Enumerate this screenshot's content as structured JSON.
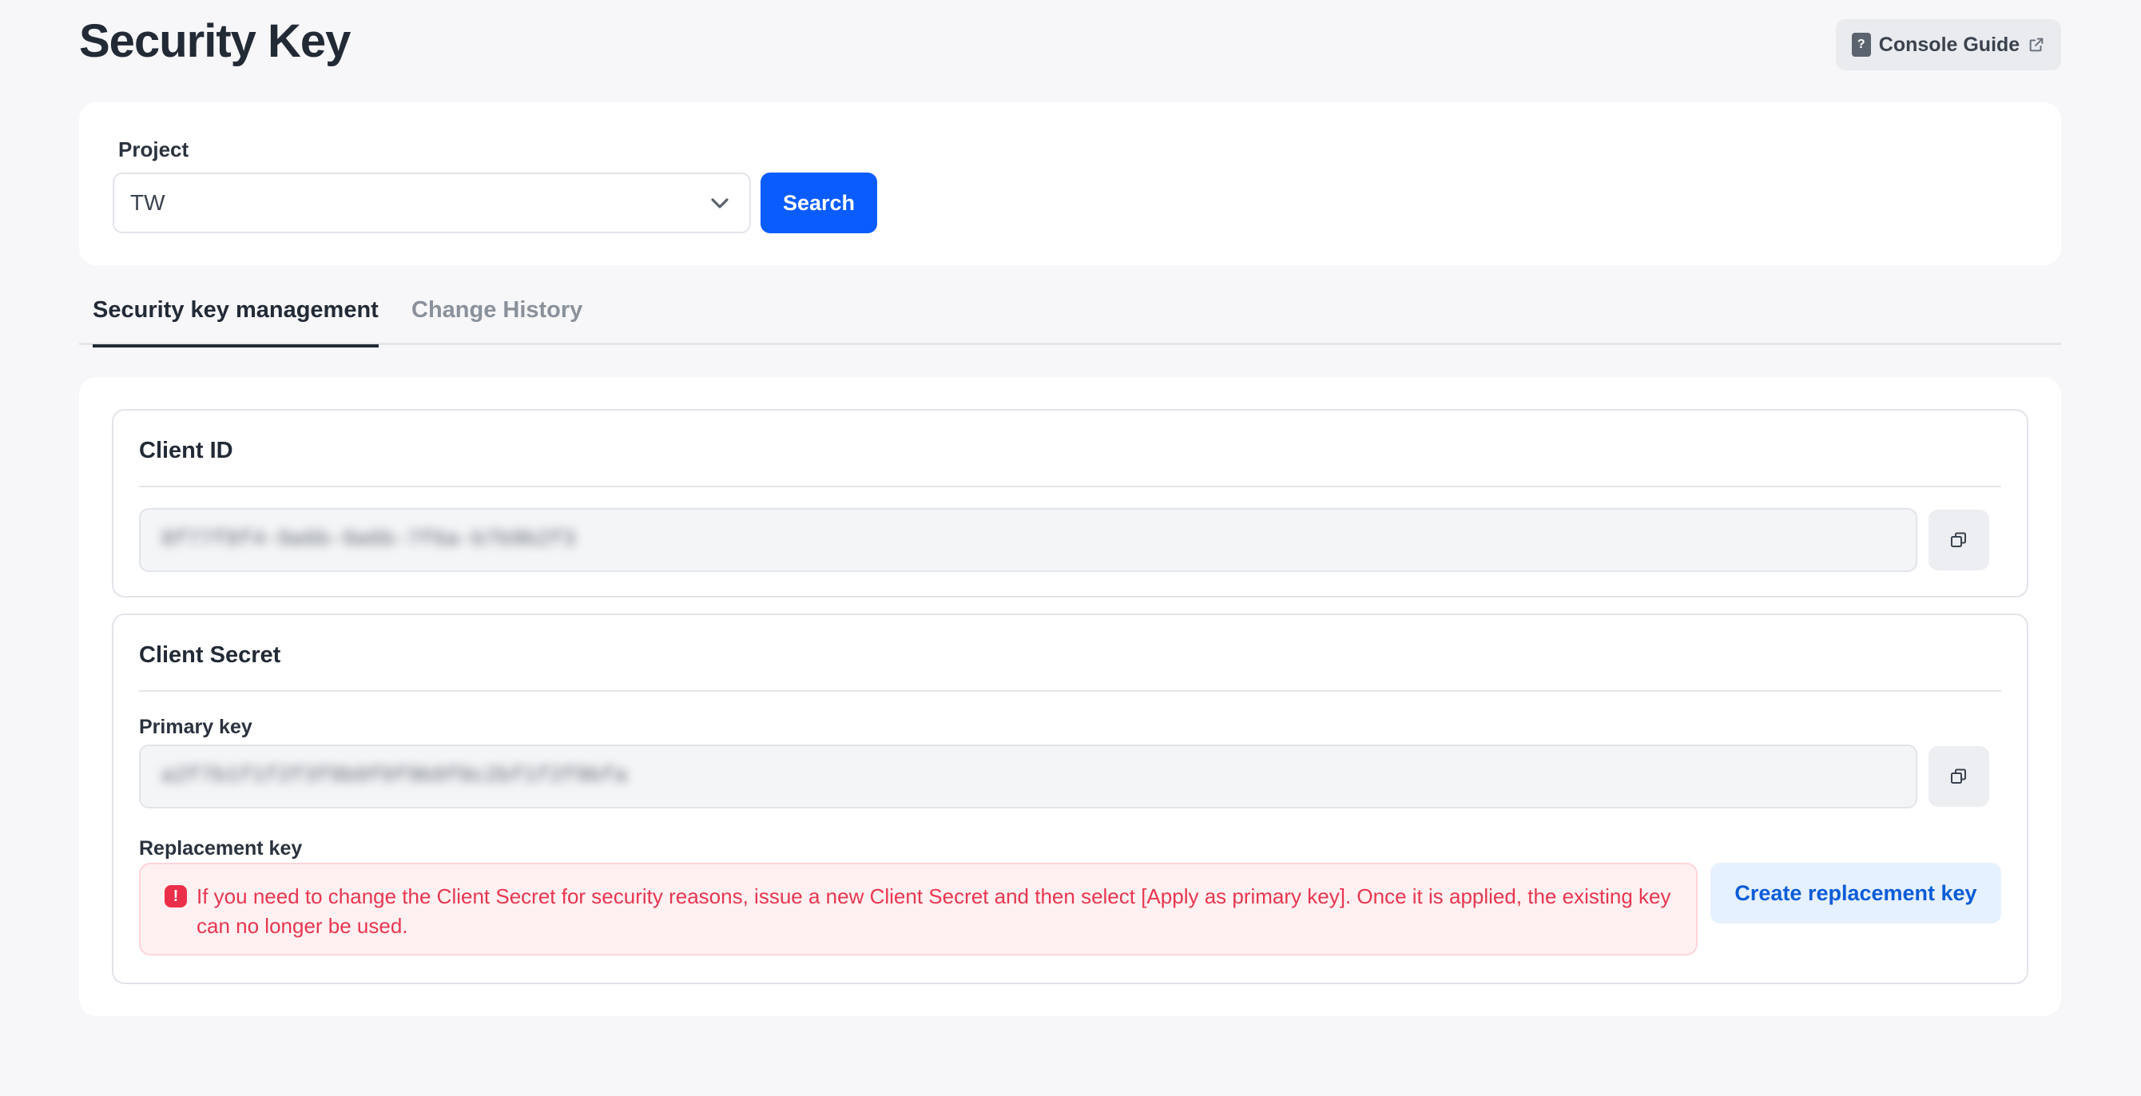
{
  "header": {
    "title": "Security Key",
    "guide_button_label": "Console Guide",
    "guide_doc_glyph": "?"
  },
  "search": {
    "project_label": "Project",
    "project_value": "TW",
    "search_button_label": "Search"
  },
  "tabs": [
    {
      "label": "Security key management",
      "active": true
    },
    {
      "label": "Change History",
      "active": false
    }
  ],
  "client_id": {
    "title": "Client ID",
    "value": "8f77f8f4-9a6b-9a6b-7f6a-b7b9b2f3"
  },
  "client_secret": {
    "title": "Client Secret",
    "primary_label": "Primary key",
    "primary_value": "a2f7b1f1f2f3f9b9f0f9b9f0c2bf1f2f9bfa",
    "replacement_label": "Replacement key",
    "alert_icon_glyph": "!",
    "alert_text": "If you need to change the Client Secret for security reasons, issue a new Client Secret and then select [Apply as primary key]. Once it is applied, the existing key can no longer be used.",
    "create_button_label": "Create replacement key"
  },
  "icons": {
    "guide_doc": "document-question-icon",
    "guide_external": "external-link-icon",
    "select_chevron": "chevron-down-icon",
    "copy": "copy-icon",
    "alert": "alert-icon"
  },
  "colors": {
    "primary": "#0a5cff",
    "alert_text": "#e8364f",
    "alert_bg": "#fff1f2",
    "secondary_button_bg": "#e6f1ff"
  }
}
